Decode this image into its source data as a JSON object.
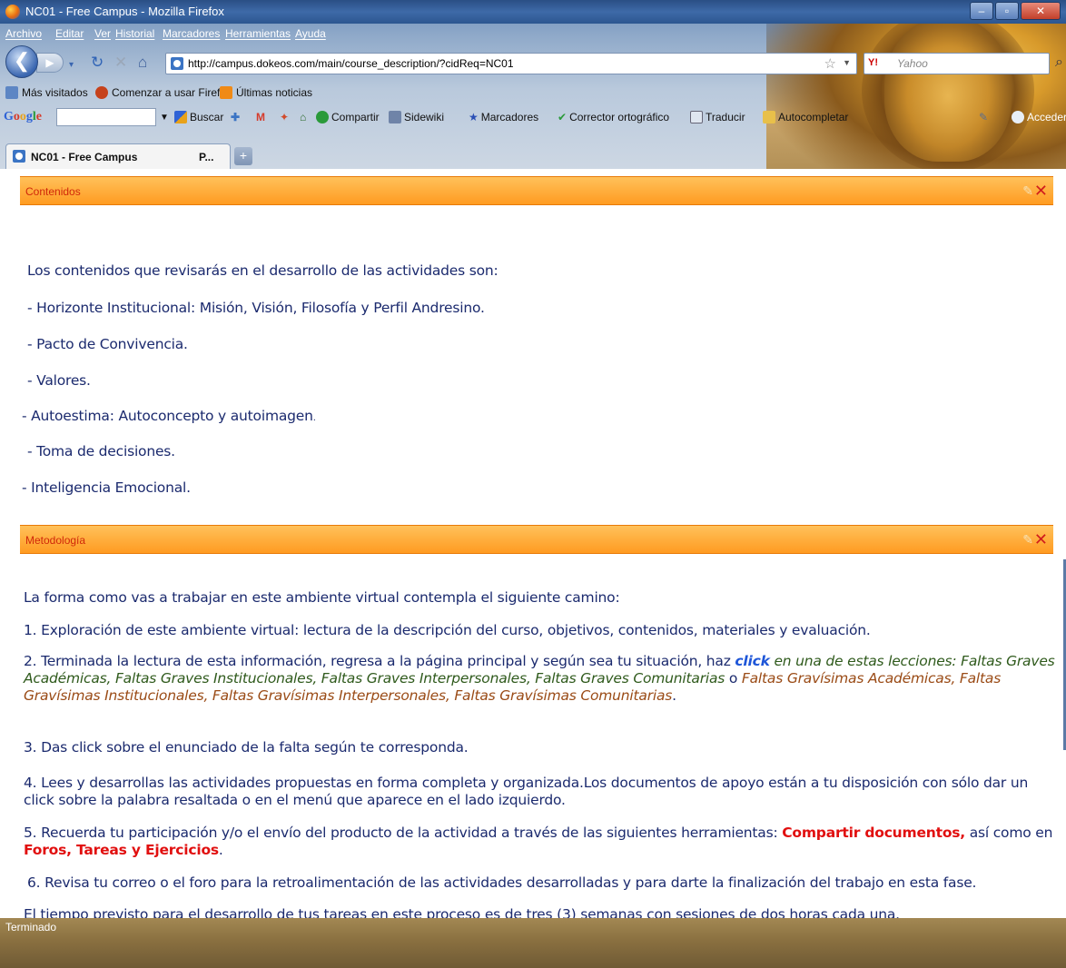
{
  "window": {
    "title": "NC01 - Free Campus - Mozilla Firefox",
    "min": "–",
    "max": "▫",
    "close": "✕"
  },
  "menu": [
    "Archivo",
    "Editar",
    "Ver",
    "Historial",
    "Marcadores",
    "Herramientas",
    "Ayuda"
  ],
  "navigation": {
    "url": "http://campus.dokeos.com/main/course_description/?cidReq=NC01",
    "search_engine": "Y!",
    "search_placeholder": "Yahoo"
  },
  "bookmarks": [
    "Más visitados",
    "Comenzar a usar Firefox",
    "Últimas noticias"
  ],
  "googlebar": {
    "logo": "Google",
    "items": [
      "Buscar",
      "Compartir",
      "Sidewiki",
      "Marcadores",
      "Corrector ortográfico",
      "Traducir",
      "Autocompletar",
      "Acceder"
    ]
  },
  "tabs": {
    "active_label": "NC01 - Free Campus",
    "second_label": "P...",
    "new_tab": "+"
  },
  "contenidos": {
    "title": "Contenidos",
    "intro": "Los contenidos que revisarás en el desarrollo de las actividades son:",
    "items": [
      "- Horizonte Institucional: Misión, Visión, Filosofía y Perfil Andresino.",
      "- Pacto de Convivencia.",
      "- Valores.",
      "- Autoestima: Autoconcepto y autoimagen",
      "- Toma de decisiones.",
      "- Inteligencia Emocional."
    ],
    "item3_tail": "."
  },
  "metodologia": {
    "title": "Metodología",
    "intro": "La forma como vas a trabajar en este ambiente virtual contempla el siguiente camino:",
    "p1": "1. Exploración de este ambiente virtual: lectura de la descripción del curso, objetivos, contenidos, materiales y evaluación.",
    "p2_a": "2. Terminada la lectura de esta información, regresa a la página principal y según sea tu situación, haz ",
    "p2_click": "click",
    "p2_b": " en una de estas lecciones: ",
    "p2_green": "Faltas Graves Académicas, Faltas Graves Institucionales, Faltas Graves Interpersonales, Faltas Graves Comunitarias",
    "p2_o": "  o ",
    "p2_brown": "Faltas Gravísimas Académicas, Faltas Gravísimas Institucionales, Faltas Gravísimas Interpersonales, Faltas Gravísimas Comunitarias",
    "p2_end": ".",
    "p3": "3. Das click sobre el enunciado de la falta según te corresponda.",
    "p4": "4. Lees y desarrollas las actividades propuestas en forma completa y organizada.Los documentos de apoyo están a tu disposición con sólo dar un click sobre la palabra resaltada o en el menú que aparece en el lado izquierdo.",
    "p5_a": "5. Recuerda tu participación y/o el envío del producto de la actividad a través de las siguientes herramientas: ",
    "p5_red1": "Compartir documentos,",
    "p5_b": " así como en ",
    "p5_red2": "Foros, Tareas y Ejercicios",
    "p5_end": ".",
    "p6": "6. Revisa tu correo o el foro para la retroalimentación de las actividades desarrolladas y para darte la finalización del trabajo en esta fase.",
    "p7": "El tiempo previsto para el desarrollo de tus tareas en este proceso es de tres (3) semanas con sesiones de dos horas cada una."
  },
  "status": {
    "text": "Terminado"
  },
  "colors": {
    "section_header": "#ff9b21",
    "body_text": "#1b2a6e",
    "red_emphasis": "#e10f0f",
    "link_blue": "#1e56d8"
  }
}
